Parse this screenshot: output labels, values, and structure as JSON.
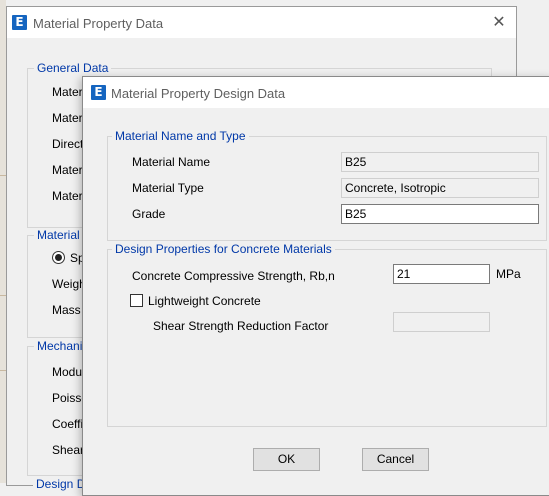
{
  "back_window": {
    "title": "Material Property Data",
    "close_glyph": "✕",
    "general_data": {
      "legend": "General Data",
      "rows": [
        "Materi",
        "Materi",
        "Directi",
        "Materi",
        "Materi"
      ]
    },
    "material_weight": {
      "legend": "Material W",
      "option_label": "Sp",
      "rows": [
        "Weigh",
        "Mass p"
      ]
    },
    "mechanical": {
      "legend": "Mechanic",
      "rows": [
        "Modulu",
        "Poisso",
        "Coeffic",
        "Shear"
      ]
    },
    "bottom_legend": "Design D"
  },
  "front_window": {
    "title": "Material Property Design Data",
    "name_type": {
      "legend": "Material Name and Type",
      "material_name_label": "Material Name",
      "material_name_value": "B25",
      "material_type_label": "Material Type",
      "material_type_value": "Concrete, Isotropic",
      "grade_label": "Grade",
      "grade_value": "B25"
    },
    "design": {
      "legend": "Design Properties for Concrete Materials",
      "strength_label": "Concrete Compressive Strength, Rb,n",
      "strength_value": "21",
      "strength_unit": "MPa",
      "lightweight_label": "Lightweight Concrete",
      "lightweight_checked": false,
      "shear_factor_label": "Shear Strength Reduction Factor",
      "shear_factor_value": ""
    },
    "buttons": {
      "ok": "OK",
      "cancel": "Cancel"
    }
  },
  "icons": {
    "app": "E",
    "app_color": "#1565c0",
    "legend_color": "#0038a8"
  }
}
